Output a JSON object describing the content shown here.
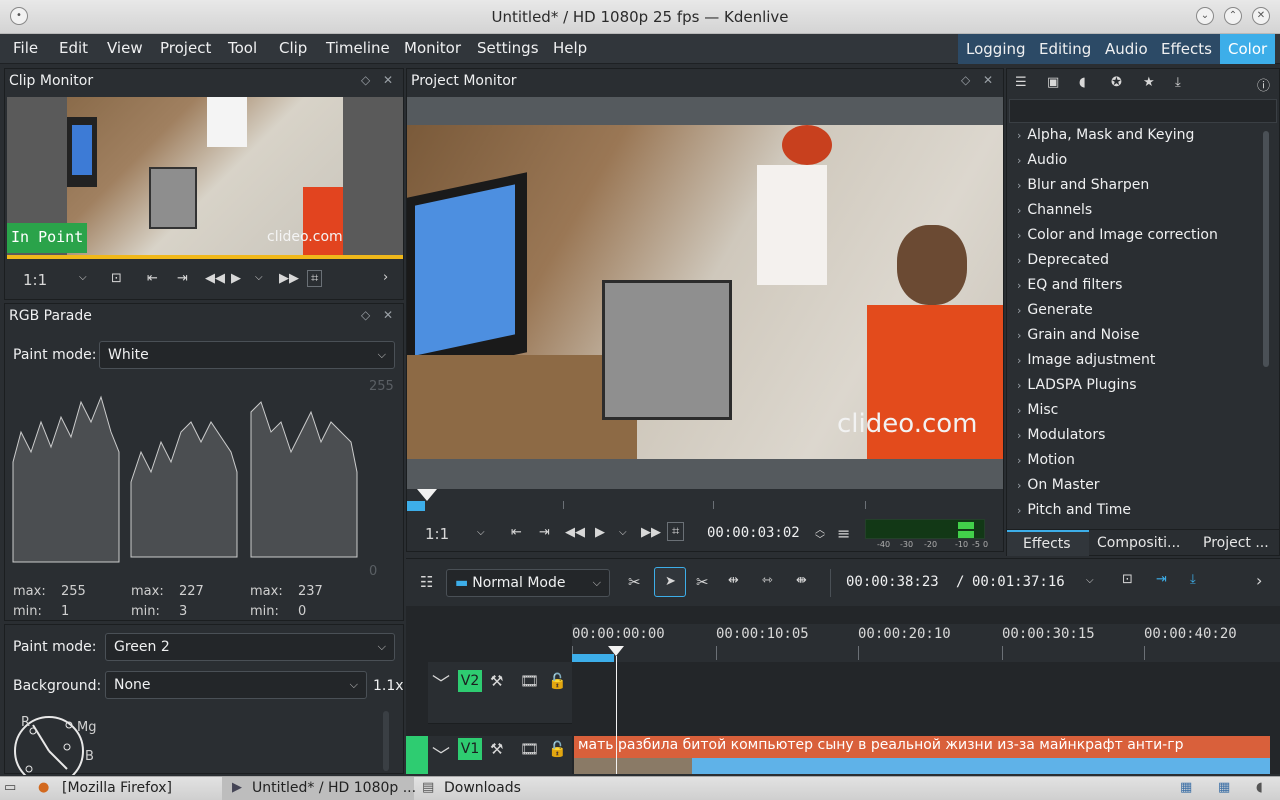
{
  "window": {
    "title": "Untitled* / HD 1080p 25 fps — Kdenlive"
  },
  "menu": [
    "File",
    "Edit",
    "View",
    "Project",
    "Tool",
    "Clip",
    "Timeline",
    "Monitor",
    "Settings",
    "Help"
  ],
  "workspaces": [
    "Logging",
    "Editing",
    "Audio",
    "Effects",
    "Color"
  ],
  "clip_monitor": {
    "title": "Clip Monitor",
    "overlay": "In Point",
    "watermark": "clideo.com",
    "zoom": "1:1"
  },
  "project_monitor": {
    "title": "Project Monitor",
    "watermark": "clideo.com",
    "zoom": "1:1",
    "timecode": "00:00:03:02",
    "meter_labels": [
      "-40",
      "-30",
      "-20",
      "-10",
      "-5",
      "0"
    ]
  },
  "rgb_parade": {
    "title": "RGB Parade",
    "paint_mode_label": "Paint mode:",
    "paint_mode_value": "White",
    "scale_top": "255",
    "scale_bottom": "0",
    "channels": [
      {
        "max_label": "max:",
        "max": "255",
        "min_label": "min:",
        "min": "1"
      },
      {
        "max_label": "max:",
        "max": "227",
        "min_label": "min:",
        "min": "3"
      },
      {
        "max_label": "max:",
        "max": "237",
        "min_label": "min:",
        "min": "0"
      }
    ]
  },
  "vectorscope": {
    "paint_mode_label": "Paint mode:",
    "paint_mode_value": "Green 2",
    "background_label": "Background:",
    "background_value": "None",
    "gain": "1.1x",
    "labels": [
      "R",
      "Mg",
      "B"
    ]
  },
  "effects": {
    "categories": [
      "Alpha, Mask and Keying",
      "Audio",
      "Blur and Sharpen",
      "Channels",
      "Color and Image correction",
      "Deprecated",
      "EQ and filters",
      "Generate",
      "Grain and Noise",
      "Image adjustment",
      "LADSPA Plugins",
      "Misc",
      "Modulators",
      "Motion",
      "On Master",
      "Pitch and Time"
    ],
    "tabs": [
      "Effects",
      "Compositi...",
      "Project ..."
    ]
  },
  "timeline": {
    "mode": "Normal Mode",
    "position": "00:00:38:23",
    "separator": "/",
    "duration": "00:01:37:16",
    "ruler": [
      "00:00:00:00",
      "00:00:10:05",
      "00:00:20:10",
      "00:00:30:15",
      "00:00:40:20"
    ],
    "tracks": [
      {
        "name": "V2"
      },
      {
        "name": "V1"
      }
    ],
    "clip_title": "мать разбила битой компьютер сыну в реальной жизни из-за майнкрафт анти-гр"
  },
  "taskbar": {
    "items": [
      "[Mozilla Firefox]",
      "Untitled* / HD 1080p ...",
      "Downloads"
    ]
  },
  "colors": {
    "accent": "#3daee9",
    "panel_bg": "#2a2e32",
    "track_green": "#2ecc71",
    "clip_orange": "#d9603b"
  }
}
